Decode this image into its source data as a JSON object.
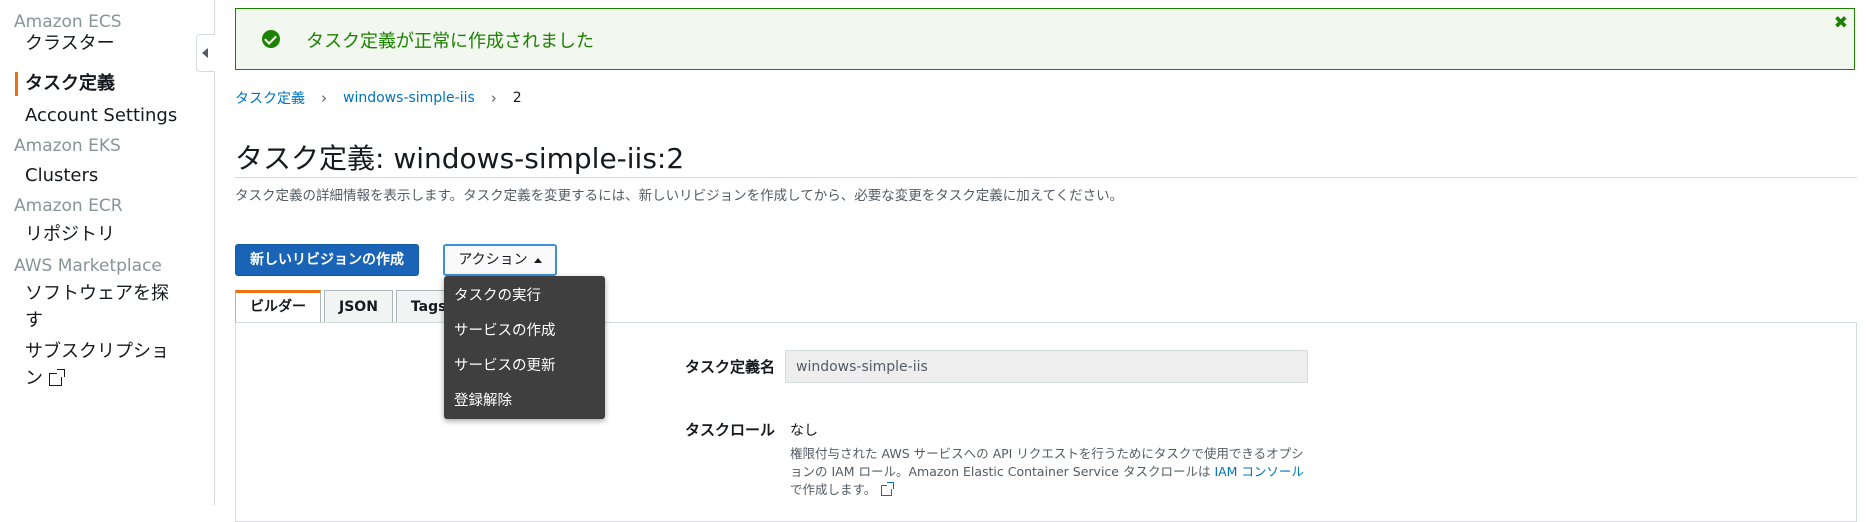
{
  "sidebar": {
    "sections": [
      {
        "title": "Amazon ECS",
        "items": [
          "クラスター",
          "タスク定義",
          "Account Settings"
        ]
      },
      {
        "title": "Amazon EKS",
        "items": [
          "Clusters"
        ]
      },
      {
        "title": "Amazon ECR",
        "items": [
          "リポジトリ"
        ]
      },
      {
        "title": "AWS Marketplace",
        "items": [
          "ソフトウェアを探す",
          "サブスクリプション"
        ]
      }
    ],
    "active_item": "タスク定義"
  },
  "flash": {
    "message": "タスク定義が正常に作成されました",
    "close": "✖"
  },
  "breadcrumb": {
    "items": [
      "タスク定義",
      "windows-simple-iis",
      "2"
    ],
    "separator": "›"
  },
  "page": {
    "title": "タスク定義: windows-simple-iis:2",
    "description": "タスク定義の詳細情報を表示します。タスク定義を変更するには、新しいリビジョンを作成してから、必要な変更をタスク定義に加えてください。"
  },
  "buttons": {
    "create_revision": "新しいリビジョンの作成",
    "actions": "アクション"
  },
  "actions_menu": [
    "タスクの実行",
    "サービスの作成",
    "サービスの更新",
    "登録解除"
  ],
  "tabs": [
    "ビルダー",
    "JSON",
    "Tags"
  ],
  "form": {
    "task_def_name_label": "タスク定義名",
    "task_def_name_value": "windows-simple-iis",
    "task_role_label": "タスクロール",
    "task_role_value": "なし",
    "help_part1": "権限付与された AWS サービスへの API リクエストを行うためにタスクで使用できるオプションの IAM ロール。Amazon Elastic Container Service タスクロールは ",
    "help_link": "IAM コンソール",
    "help_part2": "で作成します。"
  },
  "colors": {
    "accent": "#ec7211",
    "primary": "#1a64b8",
    "success": "#1d8102",
    "link": "#0073bb"
  }
}
